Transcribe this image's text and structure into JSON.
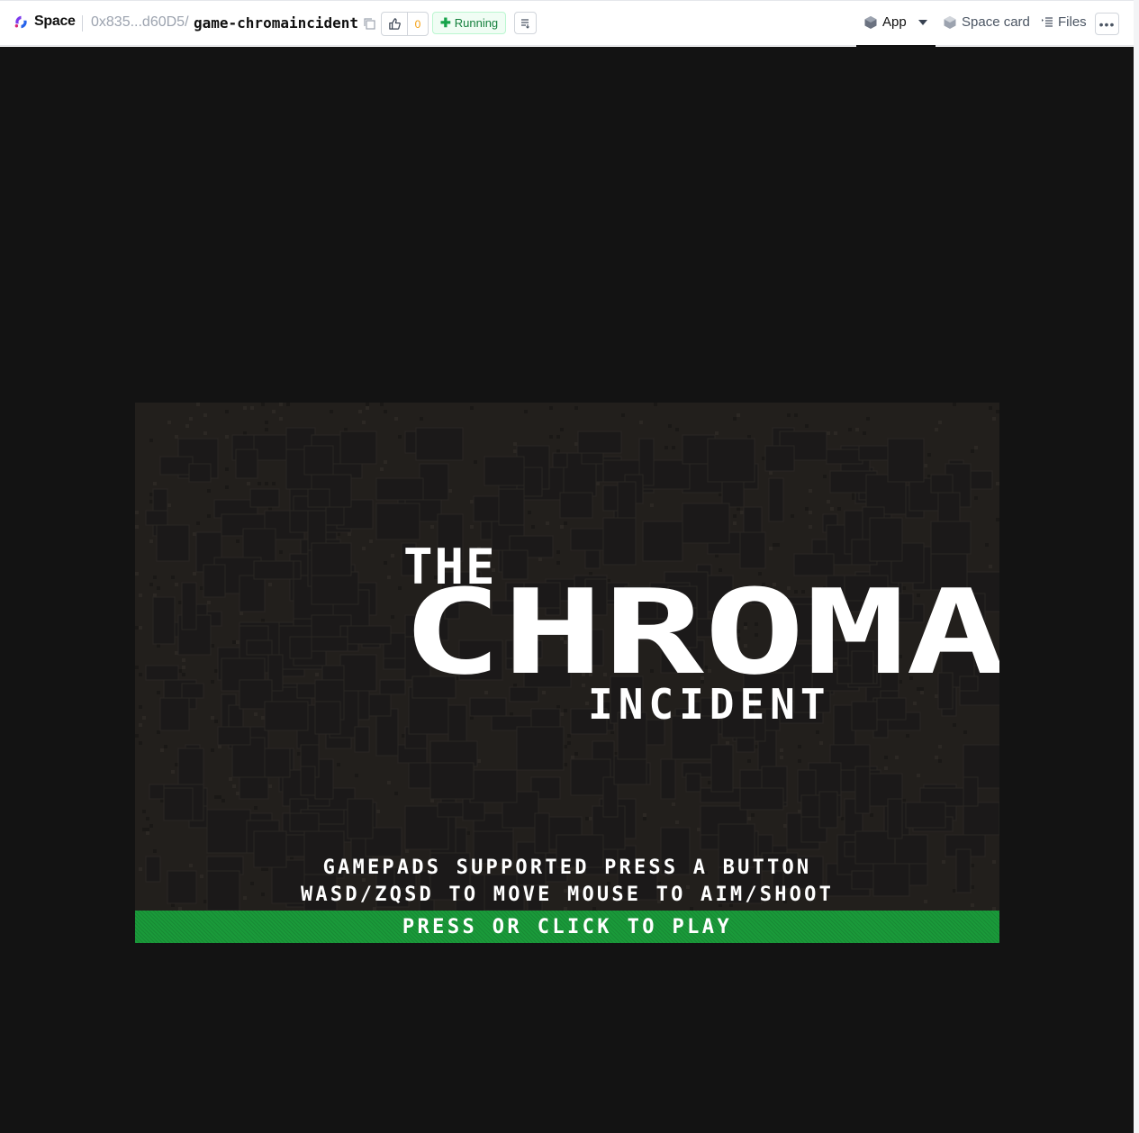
{
  "header": {
    "brand": "Space",
    "owner": "0x835...d60D5/",
    "repo": "game-chromaincident",
    "likes": "0",
    "status": "Running",
    "status_color": "#16a34a",
    "tabs": {
      "app": "App",
      "space_card": "Space card",
      "files": "Files"
    },
    "more": "•••"
  },
  "game": {
    "title_top": "THE",
    "title_main": "CHROMA",
    "title_bottom": "INCIDENT",
    "line1": "GAMEPADS SUPPORTED PRESS A BUTTON",
    "line2": "WASD/ZQSD TO MOVE   MOUSE TO AIM/SHOOT",
    "play_prompt": "PRESS OR CLICK TO PLAY",
    "colors": {
      "background": "#131313",
      "panel": "#221f1c",
      "play_bar": "#1a9a3a",
      "text": "#ffffff"
    }
  }
}
